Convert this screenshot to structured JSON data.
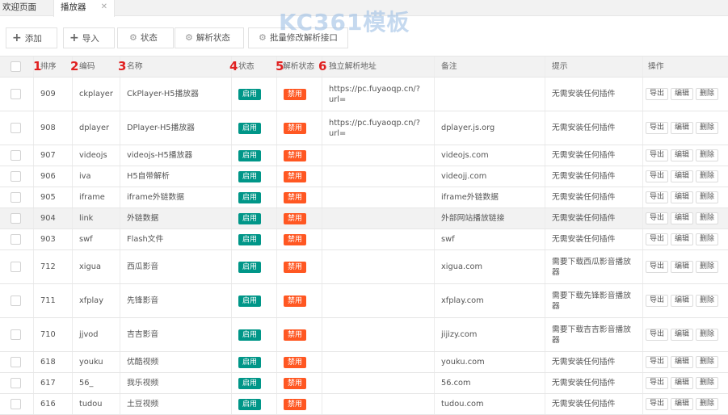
{
  "tabs": [
    {
      "label": "欢迎页面"
    },
    {
      "label": "播放器",
      "close": "✕"
    }
  ],
  "watermark": {
    "text": "KC361模板"
  },
  "toolbar": {
    "add": "添加",
    "import": "导入",
    "status": "状态",
    "parse_status": "解析状态",
    "batch": "批量修改解析接口"
  },
  "columns": {
    "sort": "排序",
    "code": "编码",
    "name": "名称",
    "status": "状态",
    "parse_status": "解析状态",
    "parse_url": "独立解析地址",
    "remark": "备注",
    "hint": "提示",
    "ops": "操作"
  },
  "annotations": [
    "1",
    "2",
    "3",
    "4",
    "5",
    "6"
  ],
  "labels": {
    "on": "启用",
    "off": "禁用",
    "export": "导出",
    "edit": "编辑",
    "delete": "删除"
  },
  "rows": [
    {
      "sort": "909",
      "code": "ckplayer",
      "name": "CkPlayer-H5播放器",
      "url": "https://pc.fuyaoqp.cn/?url=",
      "remark": "",
      "hint": "无需安装任何插件"
    },
    {
      "sort": "908",
      "code": "dplayer",
      "name": "DPlayer-H5播放器",
      "url": "https://pc.fuyaoqp.cn/?url=",
      "remark": "dplayer.js.org",
      "hint": "无需安装任何插件"
    },
    {
      "sort": "907",
      "code": "videojs",
      "name": "videojs-H5播放器",
      "url": "",
      "remark": "videojs.com",
      "hint": "无需安装任何插件"
    },
    {
      "sort": "906",
      "code": "iva",
      "name": "H5自带解析",
      "url": "",
      "remark": "videojj.com",
      "hint": "无需安装任何插件"
    },
    {
      "sort": "905",
      "code": "iframe",
      "name": "iframe外链数据",
      "url": "",
      "remark": "iframe外链数据",
      "hint": "无需安装任何插件"
    },
    {
      "sort": "904",
      "code": "link",
      "name": "外链数据",
      "url": "",
      "remark": "外部网站播放链接",
      "hint": "无需安装任何插件"
    },
    {
      "sort": "903",
      "code": "swf",
      "name": "Flash文件",
      "url": "",
      "remark": "swf",
      "hint": "无需安装任何插件"
    },
    {
      "sort": "712",
      "code": "xigua",
      "name": "西瓜影音",
      "url": "",
      "remark": "xigua.com",
      "hint": "需要下载西瓜影音播放器"
    },
    {
      "sort": "711",
      "code": "xfplay",
      "name": "先锋影音",
      "url": "",
      "remark": "xfplay.com",
      "hint": "需要下载先锋影音播放器"
    },
    {
      "sort": "710",
      "code": "jjvod",
      "name": "吉吉影音",
      "url": "",
      "remark": "jijizy.com",
      "hint": "需要下载吉吉影音播放器"
    },
    {
      "sort": "618",
      "code": "youku",
      "name": "优酷视频",
      "url": "",
      "remark": "youku.com",
      "hint": "无需安装任何插件"
    },
    {
      "sort": "617",
      "code": "56_",
      "name": "我乐视频",
      "url": "",
      "remark": "56.com",
      "hint": "无需安装任何插件"
    },
    {
      "sort": "616",
      "code": "tudou",
      "name": "土豆视频",
      "url": "",
      "remark": "tudou.com",
      "hint": "无需安装任何插件"
    }
  ]
}
